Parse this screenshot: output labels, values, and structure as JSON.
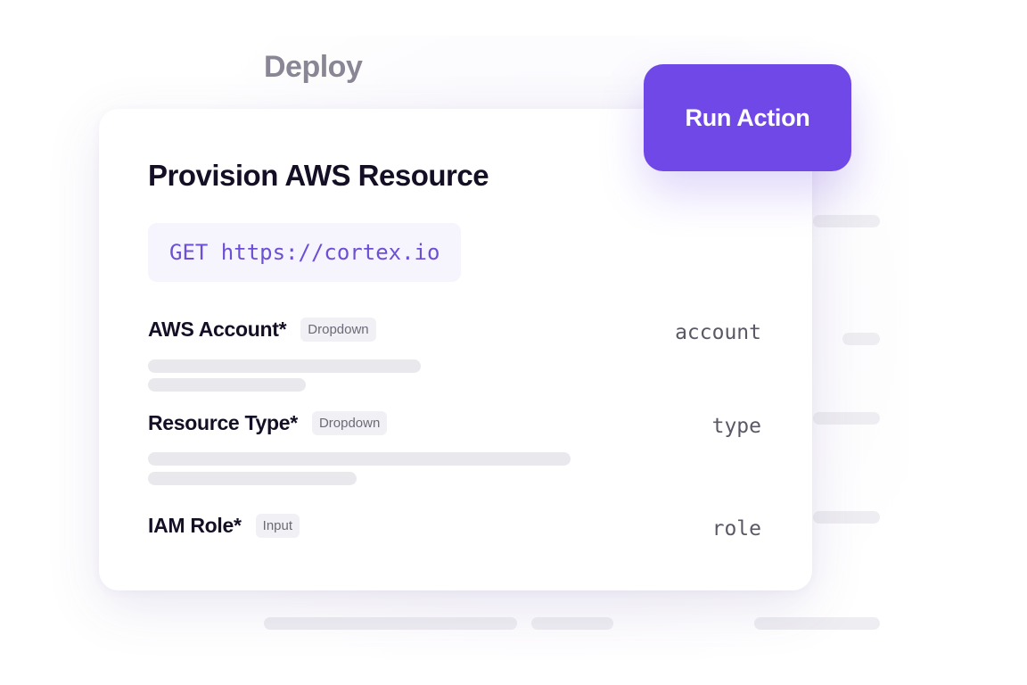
{
  "background": {
    "title": "Deploy"
  },
  "card": {
    "title": "Provision AWS Resource",
    "endpoint": "GET https://cortex.io",
    "fields": [
      {
        "label": "AWS Account*",
        "tag": "Dropdown",
        "key": "account"
      },
      {
        "label": "Resource Type*",
        "tag": "Dropdown",
        "key": "type"
      },
      {
        "label": "IAM Role*",
        "tag": "Input",
        "key": "role"
      }
    ]
  },
  "action_button": {
    "label": "Run Action"
  },
  "colors": {
    "accent": "#7048e8",
    "endpoint_text": "#6c4fd6",
    "heading": "#150f26",
    "muted_title": "#8a8695"
  }
}
